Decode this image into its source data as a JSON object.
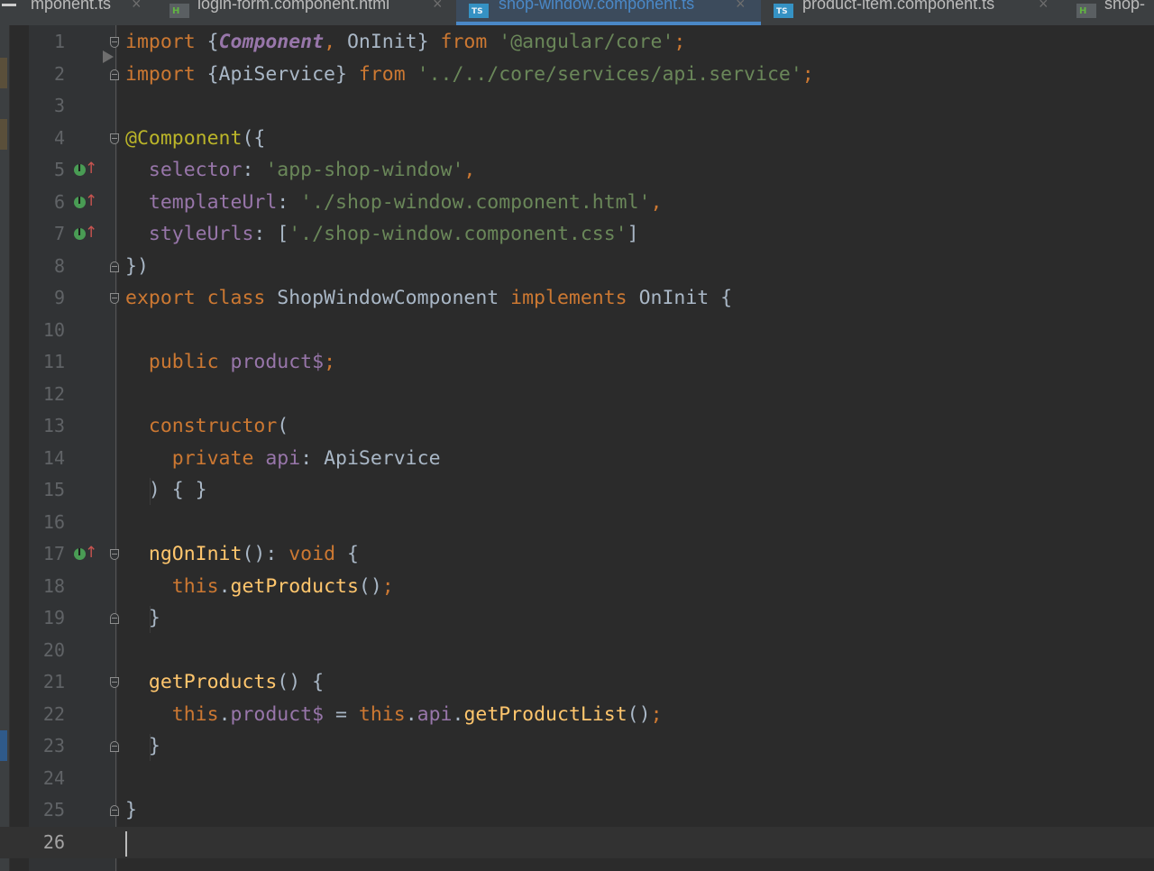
{
  "tabs": [
    {
      "label": "mponent.ts",
      "icon": "none",
      "active": false
    },
    {
      "label": "login-form.component.html",
      "icon": "html-file-icon",
      "active": false
    },
    {
      "label": "shop-window.component.ts",
      "icon": "ts-file-icon",
      "active": true
    },
    {
      "label": "product-item.component.ts",
      "icon": "ts-file-icon",
      "active": false
    },
    {
      "label": "shop-",
      "icon": "html-file-icon",
      "active": false
    }
  ],
  "icon_text": {
    "html": "H",
    "ts": "TS",
    "close": "×"
  },
  "editor": {
    "line_numbers": [
      "1",
      "2",
      "3",
      "4",
      "5",
      "6",
      "7",
      "8",
      "9",
      "10",
      "11",
      "12",
      "13",
      "14",
      "15",
      "16",
      "17",
      "18",
      "19",
      "20",
      "21",
      "22",
      "23",
      "24",
      "25",
      "26"
    ],
    "current_line": 26,
    "implementing_marks_on_lines": [
      5,
      6,
      7,
      17
    ]
  },
  "code": {
    "l1_import": "import ",
    "l1_lbrace": "{",
    "l1_component": "Component",
    "l1_comma": ", ",
    "l1_oninit": "OnInit",
    "l1_rbrace": "} ",
    "l1_from": "from ",
    "l1_str": "'@angular/core'",
    "l1_semi": ";",
    "l2_import": "import ",
    "l2_names": "{ApiService} ",
    "l2_from": "from ",
    "l2_str": "'../../core/services/api.service'",
    "l2_semi": ";",
    "l4_ann": "@Component",
    "l4_rest": "({",
    "l5_key": "  selector",
    "l5_colon": ": ",
    "l5_str": "'app-shop-window'",
    "l5_comma": ",",
    "l6_key": "  templateUrl",
    "l6_colon": ": ",
    "l6_str": "'./shop-window.component.html'",
    "l6_comma": ",",
    "l7_key": "  styleUrls",
    "l7_colon": ": [",
    "l7_str": "'./shop-window.component.css'",
    "l7_close": "]",
    "l8": "})",
    "l9_export": "export class ",
    "l9_name": "ShopWindowComponent ",
    "l9_impl": "implements ",
    "l9_oninit": "OnInit {",
    "l11_public": "  public ",
    "l11_prop": "product$",
    "l11_semi": ";",
    "l13_ctor": "  constructor",
    "l13_paren": "(",
    "l14_private": "    private ",
    "l14_prop": "api",
    "l14_type": ": ApiService",
    "l15": "  ) { }",
    "l17_fn": "  ngOnInit",
    "l17_paren": "(): ",
    "l17_void": "void ",
    "l17_brace": "{",
    "l18_this": "    this",
    "l18_dot": ".",
    "l18_call": "getProducts",
    "l18_paren": "()",
    "l18_semi": ";",
    "l19": "  }",
    "l21_fn": "  getProducts",
    "l21_rest": "() {",
    "l22_this": "    this",
    "l22_dot1": ".",
    "l22_prop": "product$",
    "l22_eq": " = ",
    "l22_this2": "this",
    "l22_dot2": ".",
    "l22_api": "api",
    "l22_dot3": ".",
    "l22_call": "getProductList",
    "l22_paren": "()",
    "l22_semi": ";",
    "l23": "  }",
    "l25": "}"
  }
}
